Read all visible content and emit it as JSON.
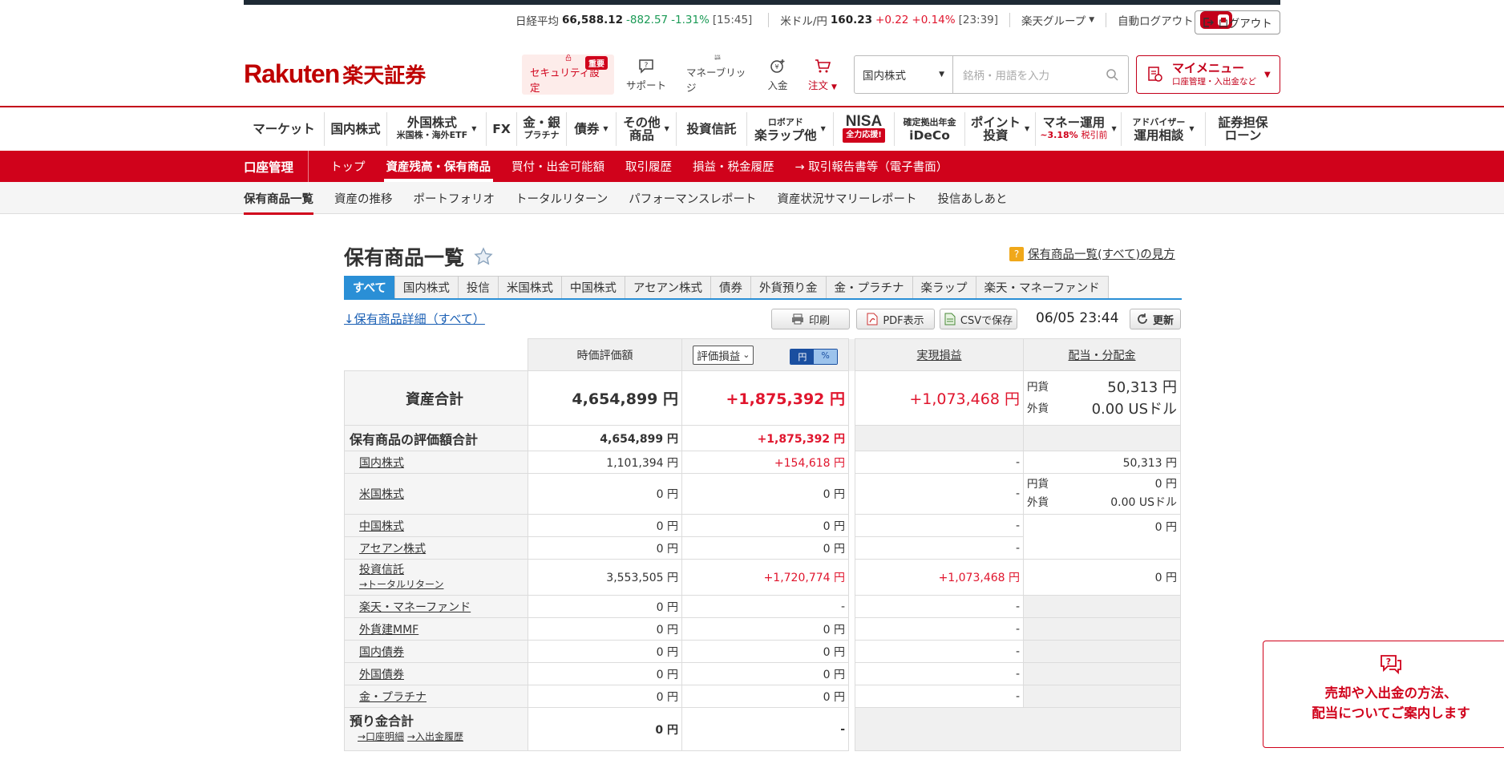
{
  "ticker": {
    "nikkei_label": "日経平均",
    "nikkei_value": "66,588.12",
    "nikkei_change": "-882.57",
    "nikkei_pct": "-1.31%",
    "nikkei_time": "[15:45]",
    "fx_label": "米ドル/円",
    "fx_value": "160.23",
    "fx_change": "+0.22",
    "fx_pct": "+0.14%",
    "fx_time": "[23:39]",
    "group_label": "楽天グループ",
    "autologout_label": "自動ログアウト",
    "logout_label": "ログアウト"
  },
  "logo": {
    "en": "Rakuten",
    "jp": "楽天証券"
  },
  "header_icons": [
    {
      "label": "セキュリティ設定",
      "badge": "重要"
    },
    {
      "label": "サポート"
    },
    {
      "label": "マネーブリッジ"
    },
    {
      "label": "入金"
    },
    {
      "label": "注文"
    }
  ],
  "search": {
    "selected": "国内株式",
    "placeholder": "銘柄・用語を入力"
  },
  "mymenu": {
    "title": "マイメニュー",
    "subtitle": "口座管理・入出金など"
  },
  "gnav": {
    "market": "マーケット",
    "domestic": "国内株式",
    "foreign_top": "外国株式",
    "foreign_sub": "米国株・海外ETF",
    "fx": "FX",
    "gold_top": "金・銀",
    "gold_sub": "プラチナ",
    "bond": "債券",
    "other_top": "その他",
    "other_sub": "商品",
    "fund": "投資信託",
    "robo_top": "ロボアド",
    "robo_sub": "楽ラップ他",
    "nisa": "NISA",
    "nisa_sub": "全力応援!",
    "ideco_top": "確定拠出年金",
    "ideco_sub": "iDeCo",
    "point_top": "ポイント",
    "point_sub": "投資",
    "money_top": "マネー運用",
    "money_rate": "~3.18%",
    "money_tax": "税引前",
    "advisor_top": "アドバイザー",
    "advisor_sub": "運用相談",
    "loan_top": "証券担保",
    "loan_sub": "ローン"
  },
  "account_bar": {
    "title": "口座管理",
    "tabs": [
      "トップ",
      "資産残高・保有商品",
      "買付・出金可能額",
      "取引履歴",
      "損益・税金履歴",
      "→ 取引報告書等（電子書面）"
    ]
  },
  "subnav": [
    "保有商品一覧",
    "資産の推移",
    "ポートフォリオ",
    "トータルリターン",
    "パフォーマンスレポート",
    "資産状況サマリーレポート",
    "投信あしあと"
  ],
  "page": {
    "title": "保有商品一覧",
    "howto": "保有商品一覧(すべて)の見方",
    "detail_link": "↓保有商品詳細（すべて）",
    "print": "印刷",
    "pdf": "PDF表示",
    "csv": "CSVで保存",
    "timestamp": "06/05 23:44",
    "refresh": "更新"
  },
  "product_tabs": [
    "すべて",
    "国内株式",
    "投信",
    "米国株式",
    "中国株式",
    "アセアン株式",
    "債券",
    "外貨預り金",
    "金・プラチナ",
    "楽ラップ",
    "楽天・マネーファンド"
  ],
  "table": {
    "col_value": "時価評価額",
    "col_pl_select": "評価損益",
    "unit_yen": "円",
    "unit_pct": "%",
    "col_realized": "実現損益",
    "col_dividend": "配当・分配金",
    "total": {
      "label": "資産合計",
      "value": "4,654,899 円",
      "pl": "+1,875,392 円",
      "realized": "+1,073,468 円",
      "div_jpy_label": "円貨",
      "div_jpy": "50,313 円",
      "div_fx_label": "外貨",
      "div_fx": "0.00 USドル"
    },
    "holdings_total": {
      "label": "保有商品の評価額合計",
      "value": "4,654,899 円",
      "pl": "+1,875,392 円"
    },
    "rows": [
      {
        "label": "国内株式",
        "value": "1,101,394 円",
        "pl": "+154,618 円",
        "realized": "-",
        "dividend": "50,313 円"
      },
      {
        "label": "米国株式",
        "value": "0 円",
        "pl": "0 円",
        "realized": "-",
        "div_jpy_label": "円貨",
        "div_jpy": "0 円",
        "div_fx_label": "外貨",
        "div_fx": "0.00 USドル"
      },
      {
        "label": "中国株式",
        "value": "0 円",
        "pl": "0 円",
        "realized": "-",
        "dividend": "0 円"
      },
      {
        "label": "アセアン株式",
        "value": "0 円",
        "pl": "0 円",
        "realized": "-"
      },
      {
        "label": "投資信託",
        "sublink": "→トータルリターン",
        "value": "3,553,505 円",
        "pl": "+1,720,774 円",
        "realized": "+1,073,468 円",
        "dividend": "0 円"
      },
      {
        "label": "楽天・マネーファンド",
        "value": "0 円",
        "pl": "-",
        "realized": "-"
      },
      {
        "label": "外貨建MMF",
        "value": "0 円",
        "pl": "0 円",
        "realized": "-"
      },
      {
        "label": "国内債券",
        "value": "0 円",
        "pl": "0 円",
        "realized": "-"
      },
      {
        "label": "外国債券",
        "value": "0 円",
        "pl": "0 円",
        "realized": "-"
      },
      {
        "label": "金・プラチナ",
        "value": "0 円",
        "pl": "0 円",
        "realized": "-"
      }
    ],
    "deposit": {
      "label": "預り金合計",
      "link1": "→口座明細",
      "link2": "→入出金履歴",
      "value": "0 円",
      "pl": "-"
    }
  },
  "help": {
    "line1": "売却や入出金の方法、",
    "line2": "配当についてご案内します"
  },
  "colors": {
    "brand": "#c3001a",
    "accent_blue": "#2a8fd6",
    "profit": "#e0152d",
    "loss": "#1a9a55"
  }
}
